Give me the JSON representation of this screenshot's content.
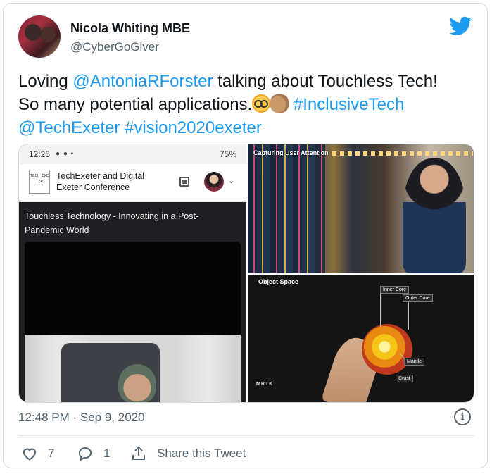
{
  "author": {
    "name": "Nicola Whiting MBE",
    "handle": "@CyberGoGiver"
  },
  "tweet": {
    "text_1": "Loving ",
    "mention_1": "@AntoniaRForster",
    "text_2": " talking about Touchless Tech!",
    "text_3": "So many  potential applications.",
    "hashtag_1": "#InclusiveTech",
    "mention_2": "@TechExeter",
    "hashtag_2": "#vision2020exeter"
  },
  "media": {
    "phone": {
      "time": "12:25",
      "battery": "75%",
      "logo_text": "TECH EXE TER",
      "conference_title_1": "TechExeter and Digital",
      "conference_title_2": "Exeter Conference",
      "session_title": "Touchless Technology - Innovating in a Post-Pandemic World"
    },
    "top_right": {
      "label": "Capturing User Attention"
    },
    "bottom_right": {
      "label": "Object Space",
      "labels": {
        "inner_core": "Inner Core",
        "outer_core": "Outer Core",
        "mantle": "Mantle",
        "crust": "Crust"
      },
      "brand": "MRTK"
    }
  },
  "footer": {
    "timestamp": "12:48 PM · Sep 9, 2020",
    "likes": "7",
    "replies": "1",
    "share_label": "Share this Tweet"
  },
  "colors": {
    "accent": "#1d9bf0",
    "muted": "#536471",
    "text": "#0f1419"
  }
}
